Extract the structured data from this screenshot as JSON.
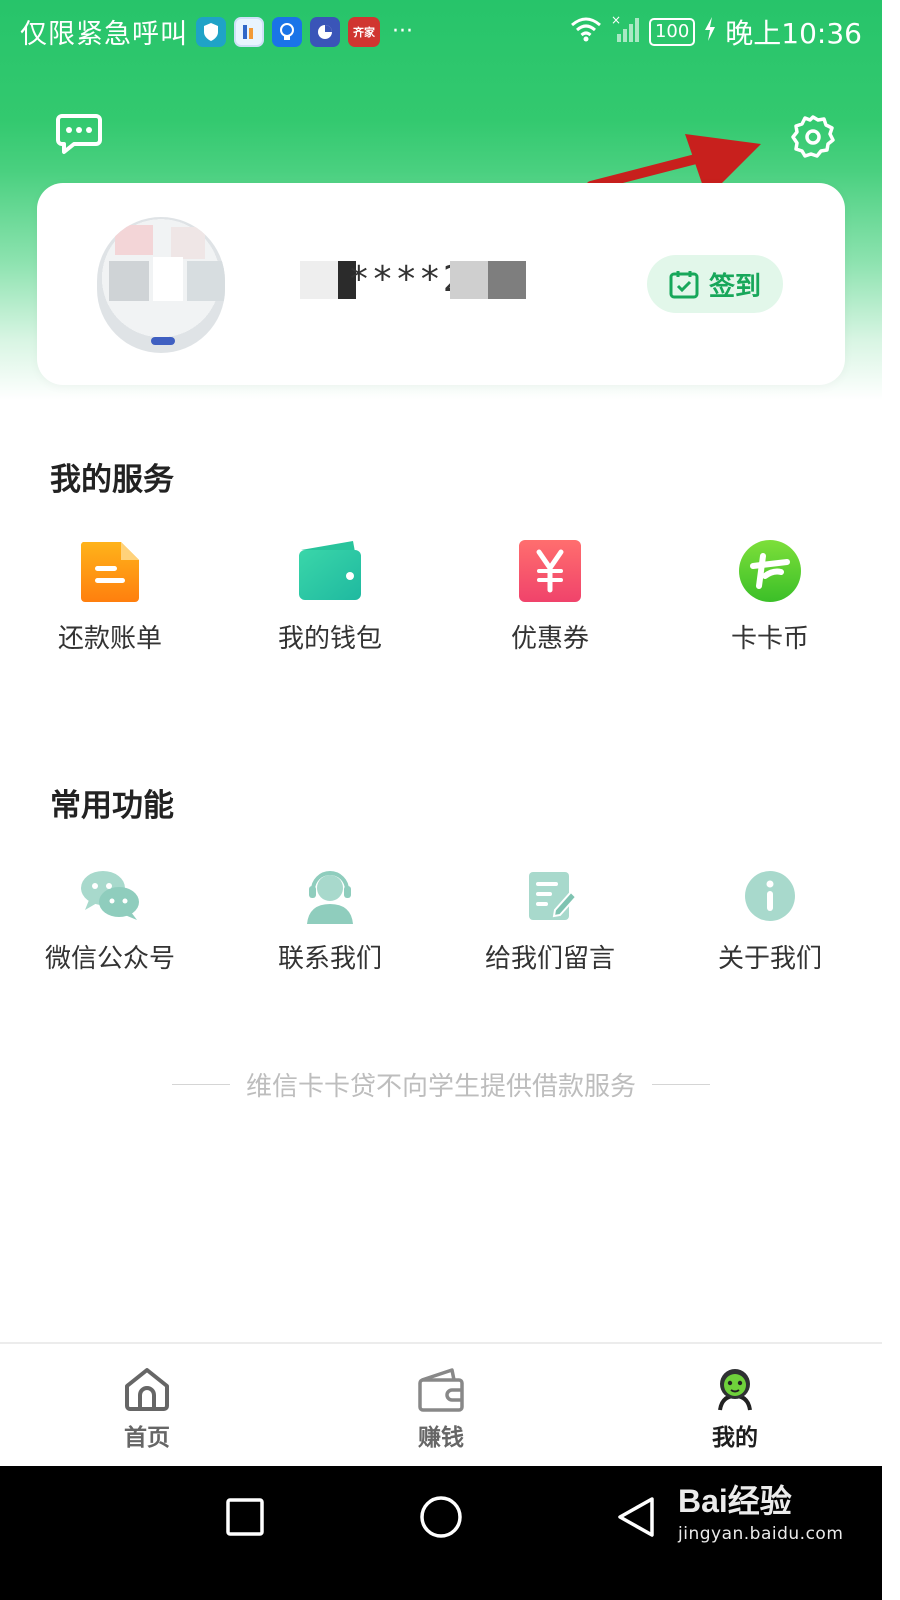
{
  "status_bar": {
    "carrier_text": "仅限紧急呼叫",
    "app5_text": "齐家",
    "more": "···",
    "battery": "100",
    "time": "晚上10:36"
  },
  "profile": {
    "username": "****2",
    "sign_in_label": "签到"
  },
  "my_services": {
    "title": "我的服务",
    "items": [
      {
        "label": "还款账单",
        "icon": "bill-icon"
      },
      {
        "label": "我的钱包",
        "icon": "wallet-icon"
      },
      {
        "label": "优惠券",
        "icon": "coupon-icon"
      },
      {
        "label": "卡卡币",
        "icon": "kaka-coin-icon"
      }
    ]
  },
  "common_functions": {
    "title": "常用功能",
    "items": [
      {
        "label": "微信公众号",
        "icon": "wechat-icon"
      },
      {
        "label": "联系我们",
        "icon": "customer-service-icon"
      },
      {
        "label": "给我们留言",
        "icon": "feedback-icon"
      },
      {
        "label": "关于我们",
        "icon": "info-icon"
      }
    ]
  },
  "disclaimer": "维信卡卡贷不向学生提供借款服务",
  "tabbar": {
    "tabs": [
      {
        "label": "首页",
        "icon": "home-icon",
        "active": false
      },
      {
        "label": "赚钱",
        "icon": "earn-wallet-icon",
        "active": false
      },
      {
        "label": "我的",
        "icon": "my-avatar-icon",
        "active": true
      }
    ]
  },
  "watermark": {
    "brand": "Bai经验",
    "url": "jingyan.baidu.com"
  },
  "colors": {
    "primary_green": "#27c46a",
    "sign_in_bg": "#e2f7ea",
    "sign_in_text": "#17a75a",
    "annotation_arrow": "#c8201d"
  }
}
